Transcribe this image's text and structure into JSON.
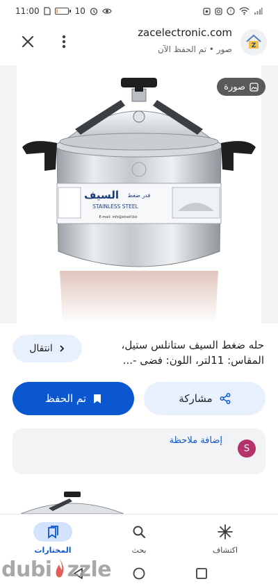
{
  "status_bar": {
    "time": "11:00",
    "battery_percent": "10",
    "battery_level": 0.1,
    "icons": [
      "sim-icon",
      "battery-icon",
      "alarm-icon",
      "eye-icon",
      "screenshot-icon",
      "instagram-icon",
      "notification-icon",
      "wifi-icon",
      "signal-icon"
    ]
  },
  "header": {
    "site_name": "zacelectronic.com",
    "site_sub": "صور • تم الحفظ الآن",
    "close_icon": "close-icon",
    "more_icon": "more-vert-icon"
  },
  "image": {
    "chip_label": "صورة",
    "label_brand": "السيف",
    "label_sub": "قدر ضغط",
    "label_line": "STAINLESS STEEL",
    "label_small": "E-mail: info@elseif.biz"
  },
  "product": {
    "title": "حله ضغط السيف ستانلس ستيل، المقاس: 11لتر، اللون: فضى -...",
    "visit_label": "انتقال"
  },
  "actions": {
    "saved_label": "تم الحفظ",
    "share_label": "مشاركة"
  },
  "note": {
    "avatar_letter": "S",
    "add_note_label": "إضافة ملاحظة"
  },
  "bottom_nav": {
    "items": [
      {
        "label": "المختارات",
        "icon": "collections-icon",
        "active": true
      },
      {
        "label": "بحث",
        "icon": "search-icon",
        "active": false
      },
      {
        "label": "اكتشاف",
        "icon": "discover-icon",
        "active": false
      }
    ]
  },
  "watermark": {
    "text": "dubizzle"
  },
  "colors": {
    "accent": "#0b57d0",
    "tonal": "#e8f0fe",
    "avatar": "#b3336a",
    "watermark_flame": "#e0433a"
  }
}
